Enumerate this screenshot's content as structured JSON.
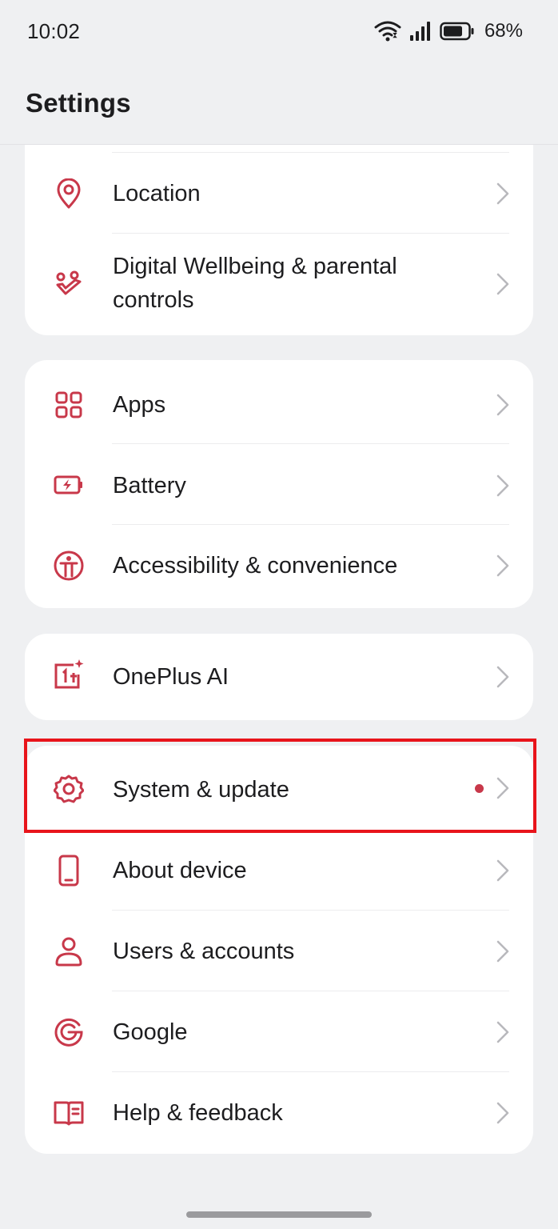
{
  "status_bar": {
    "time": "10:02",
    "battery_percent": "68%",
    "icons": [
      "wifi-icon",
      "signal-icon",
      "battery-icon"
    ]
  },
  "header": {
    "title": "Settings"
  },
  "colors": {
    "accent": "#c8384a",
    "highlight_border": "#e8141b",
    "background": "#eff0f2",
    "card": "#ffffff"
  },
  "groups": [
    {
      "items": [
        {
          "label": "Location",
          "icon": "location-pin-icon"
        },
        {
          "label": "Digital Wellbeing & parental controls",
          "icon": "wellbeing-icon"
        }
      ]
    },
    {
      "items": [
        {
          "label": "Apps",
          "icon": "apps-grid-icon"
        },
        {
          "label": "Battery",
          "icon": "battery-charging-icon"
        },
        {
          "label": "Accessibility & convenience",
          "icon": "accessibility-icon"
        }
      ]
    },
    {
      "items": [
        {
          "label": "OnePlus AI",
          "icon": "oneplus-ai-icon"
        }
      ]
    },
    {
      "items": [
        {
          "label": "System & update",
          "icon": "gear-icon",
          "badge": "notification-dot",
          "highlighted": true
        },
        {
          "label": "About device",
          "icon": "phone-icon"
        },
        {
          "label": "Users & accounts",
          "icon": "user-icon"
        },
        {
          "label": "Google",
          "icon": "google-icon"
        },
        {
          "label": "Help & feedback",
          "icon": "help-book-icon"
        }
      ]
    }
  ]
}
